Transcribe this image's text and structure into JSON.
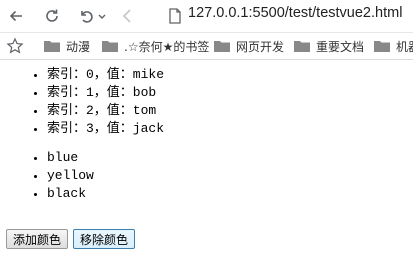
{
  "browser": {
    "url": "127.0.0.1:5500/test/testvue2.html",
    "bookmarks": [
      {
        "label": "动漫"
      },
      {
        "label": ".☆奈何★的书签"
      },
      {
        "label": "网页开发"
      },
      {
        "label": "重要文档"
      },
      {
        "label": "机器"
      }
    ]
  },
  "page": {
    "people": [
      "索引：0，值：mike",
      "索引：1，值：bob",
      "索引：2，值：tom",
      "索引：3，值：jack"
    ],
    "colors": [
      "blue",
      "yellow",
      "black"
    ],
    "add_color_button": "添加颜色",
    "remove_color_button": "移除颜色"
  }
}
